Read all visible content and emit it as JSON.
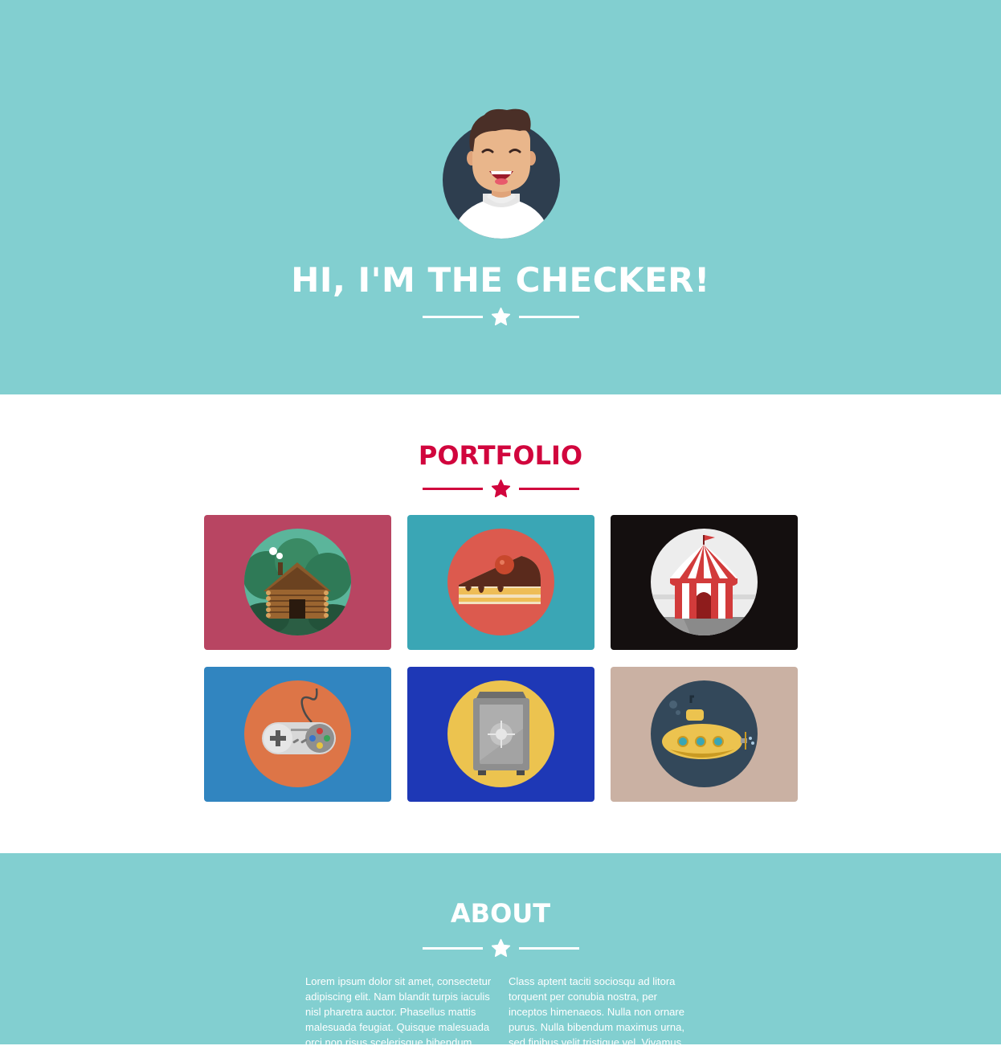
{
  "hero": {
    "title": "HI, I'M THE CHECKER!",
    "background": "#82cfd0",
    "avatar_icon": "smiling-man-avatar-icon",
    "divider_icon": "star-icon"
  },
  "portfolio": {
    "title": "PORTFOLIO",
    "accent": "#d1053d",
    "divider_icon": "star-icon",
    "items": [
      {
        "icon": "log-cabin-icon",
        "background": "#b84562"
      },
      {
        "icon": "cake-slice-icon",
        "background": "#3aa6b5"
      },
      {
        "icon": "circus-tent-icon",
        "background": "#140f0f"
      },
      {
        "icon": "game-controller-icon",
        "background": "#3185c0"
      },
      {
        "icon": "safe-icon",
        "background": "#1e38b6"
      },
      {
        "icon": "submarine-icon",
        "background": "#cab1a3"
      }
    ]
  },
  "about": {
    "title": "ABOUT",
    "divider_icon": "star-icon",
    "column_left": "Lorem ipsum dolor sit amet, consectetur adipiscing elit. Nam blandit turpis iaculis nisl pharetra auctor. Phasellus mattis malesuada feugiat. Quisque malesuada orci non risus scelerisque bibendum.",
    "column_right": "Class aptent taciti sociosqu ad litora torquent per conubia nostra, per inceptos himenaeos. Nulla non ornare purus. Nulla bibendum maximus urna, sed finibus velit tristique vel. Vivamus"
  }
}
